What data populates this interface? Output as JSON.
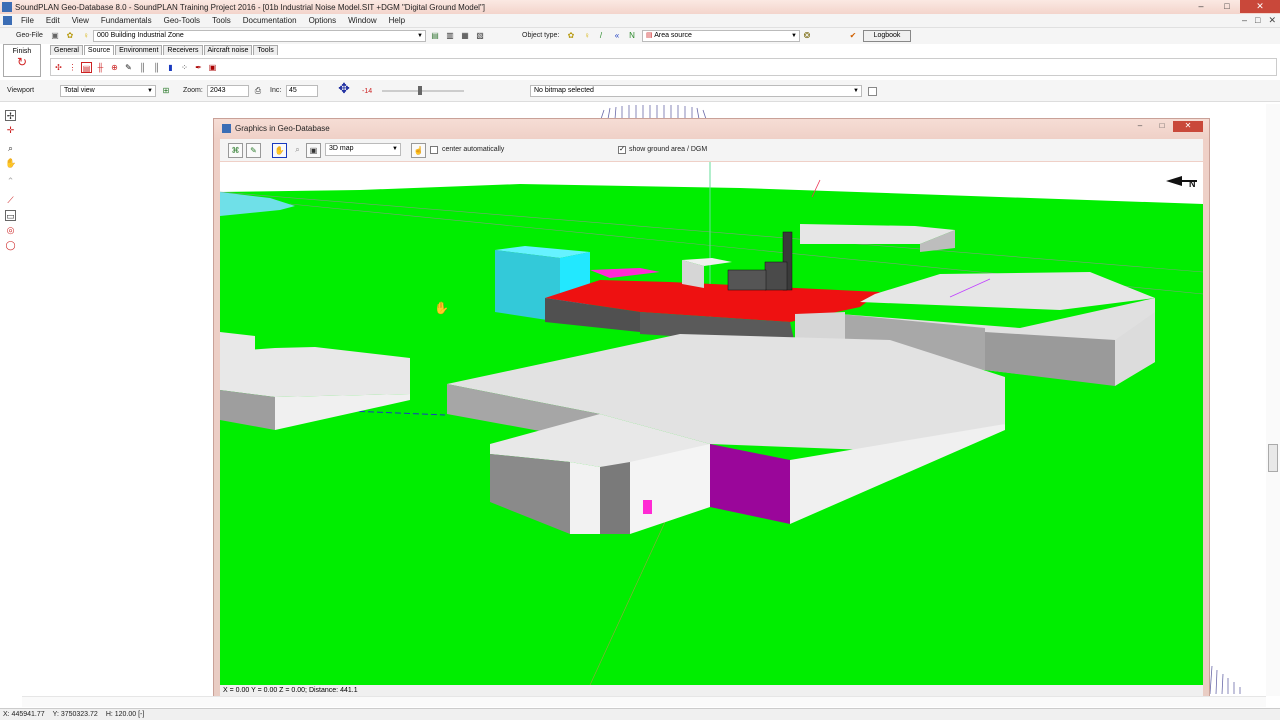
{
  "window": {
    "title": "SoundPLAN Geo-Database 8.0 - SoundPLAN Training Project 2016 - [01b Industrial Noise Model.SIT +DGM \"Digital Ground Model\"]",
    "minimize": "–",
    "maximize": "□",
    "close": "✕"
  },
  "menu": [
    "File",
    "Edit",
    "View",
    "Fundamentals",
    "Geo-Tools",
    "Tools",
    "Documentation",
    "Options",
    "Window",
    "Help"
  ],
  "menu_right": [
    "–",
    "□",
    "✕"
  ],
  "geofile": {
    "label": "Geo-File",
    "value": "000 Building Industrial Zone",
    "object_type_label": "Object type:",
    "object_type_value": "Area source",
    "logbook": "Logbook"
  },
  "finish": {
    "label": "Finish"
  },
  "tabs": [
    "General",
    "Source",
    "Environment",
    "Receivers",
    "Aircraft noise",
    "Tools"
  ],
  "active_tab": "Source",
  "viewport": {
    "label": "Viewport",
    "value": "Total view",
    "zoom_label": "Zoom:",
    "zoom_value": "2043",
    "inc_label": "Inc:",
    "inc_value": "45",
    "angle": "-14",
    "bitmap": "No bitmap selected"
  },
  "subwindow": {
    "title": "Graphics in Geo-Database",
    "mode": "3D map",
    "center_auto": "center automatically",
    "show_ground": "show ground area / DGM",
    "center_auto_checked": false,
    "show_ground_checked": true,
    "north_label": "N",
    "coords": "X = 0.00   Y = 0.00   Z = 0.00;   Distance: 441.1"
  },
  "status": {
    "x": "X: 445941.77",
    "y": "Y: 3750323.72",
    "h": "H: 120.00 [-]"
  },
  "colors": {
    "ground": "#00ee00",
    "building_top": "#e6e6e6",
    "building_side": "#9a9a9a",
    "roof_red": "#ee1111",
    "cyan_block": "#33ddee",
    "magenta": "#9a069a",
    "pink": "#ff2ad4"
  }
}
